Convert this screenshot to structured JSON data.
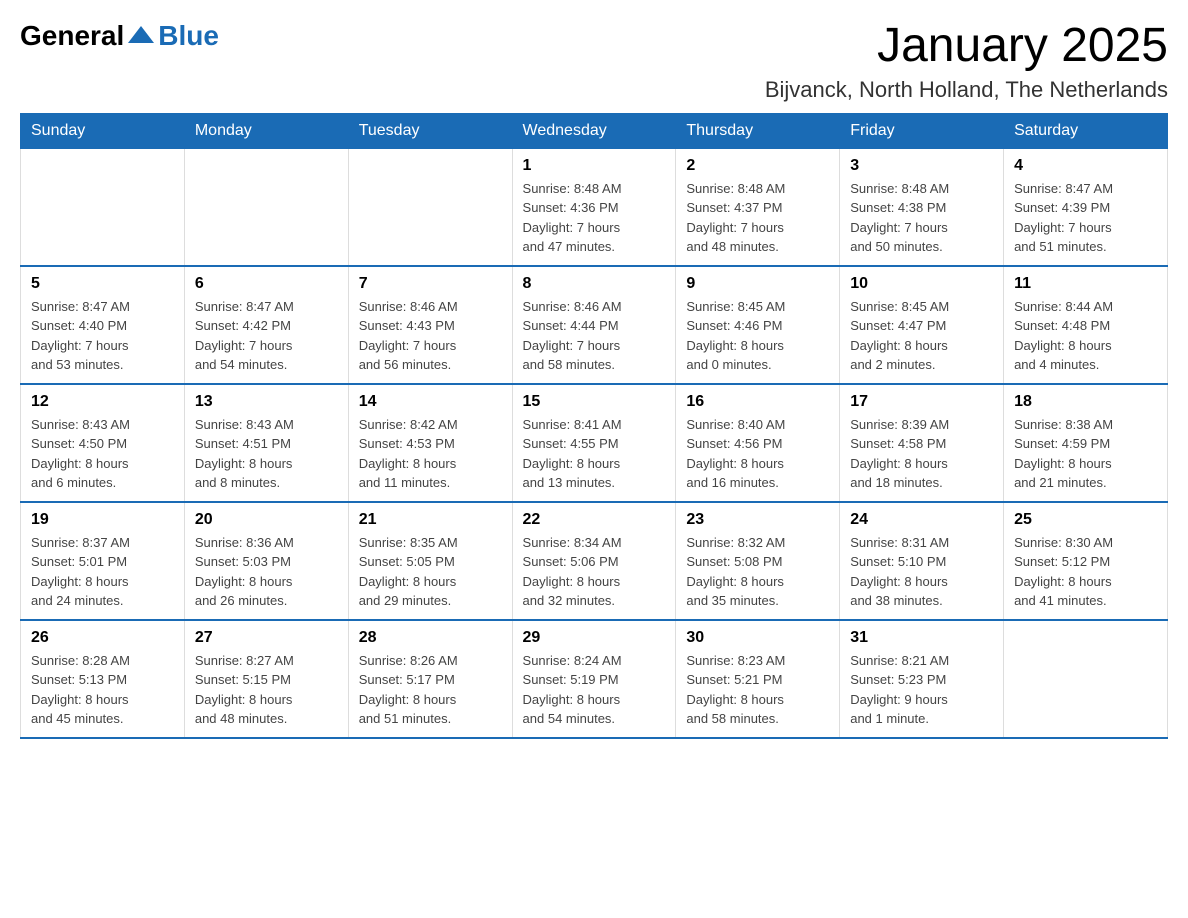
{
  "logo": {
    "general": "General",
    "blue": "Blue"
  },
  "header": {
    "month": "January 2025",
    "location": "Bijvanck, North Holland, The Netherlands"
  },
  "weekdays": [
    "Sunday",
    "Monday",
    "Tuesday",
    "Wednesday",
    "Thursday",
    "Friday",
    "Saturday"
  ],
  "weeks": [
    [
      {
        "day": "",
        "info": ""
      },
      {
        "day": "",
        "info": ""
      },
      {
        "day": "",
        "info": ""
      },
      {
        "day": "1",
        "info": "Sunrise: 8:48 AM\nSunset: 4:36 PM\nDaylight: 7 hours\nand 47 minutes."
      },
      {
        "day": "2",
        "info": "Sunrise: 8:48 AM\nSunset: 4:37 PM\nDaylight: 7 hours\nand 48 minutes."
      },
      {
        "day": "3",
        "info": "Sunrise: 8:48 AM\nSunset: 4:38 PM\nDaylight: 7 hours\nand 50 minutes."
      },
      {
        "day": "4",
        "info": "Sunrise: 8:47 AM\nSunset: 4:39 PM\nDaylight: 7 hours\nand 51 minutes."
      }
    ],
    [
      {
        "day": "5",
        "info": "Sunrise: 8:47 AM\nSunset: 4:40 PM\nDaylight: 7 hours\nand 53 minutes."
      },
      {
        "day": "6",
        "info": "Sunrise: 8:47 AM\nSunset: 4:42 PM\nDaylight: 7 hours\nand 54 minutes."
      },
      {
        "day": "7",
        "info": "Sunrise: 8:46 AM\nSunset: 4:43 PM\nDaylight: 7 hours\nand 56 minutes."
      },
      {
        "day": "8",
        "info": "Sunrise: 8:46 AM\nSunset: 4:44 PM\nDaylight: 7 hours\nand 58 minutes."
      },
      {
        "day": "9",
        "info": "Sunrise: 8:45 AM\nSunset: 4:46 PM\nDaylight: 8 hours\nand 0 minutes."
      },
      {
        "day": "10",
        "info": "Sunrise: 8:45 AM\nSunset: 4:47 PM\nDaylight: 8 hours\nand 2 minutes."
      },
      {
        "day": "11",
        "info": "Sunrise: 8:44 AM\nSunset: 4:48 PM\nDaylight: 8 hours\nand 4 minutes."
      }
    ],
    [
      {
        "day": "12",
        "info": "Sunrise: 8:43 AM\nSunset: 4:50 PM\nDaylight: 8 hours\nand 6 minutes."
      },
      {
        "day": "13",
        "info": "Sunrise: 8:43 AM\nSunset: 4:51 PM\nDaylight: 8 hours\nand 8 minutes."
      },
      {
        "day": "14",
        "info": "Sunrise: 8:42 AM\nSunset: 4:53 PM\nDaylight: 8 hours\nand 11 minutes."
      },
      {
        "day": "15",
        "info": "Sunrise: 8:41 AM\nSunset: 4:55 PM\nDaylight: 8 hours\nand 13 minutes."
      },
      {
        "day": "16",
        "info": "Sunrise: 8:40 AM\nSunset: 4:56 PM\nDaylight: 8 hours\nand 16 minutes."
      },
      {
        "day": "17",
        "info": "Sunrise: 8:39 AM\nSunset: 4:58 PM\nDaylight: 8 hours\nand 18 minutes."
      },
      {
        "day": "18",
        "info": "Sunrise: 8:38 AM\nSunset: 4:59 PM\nDaylight: 8 hours\nand 21 minutes."
      }
    ],
    [
      {
        "day": "19",
        "info": "Sunrise: 8:37 AM\nSunset: 5:01 PM\nDaylight: 8 hours\nand 24 minutes."
      },
      {
        "day": "20",
        "info": "Sunrise: 8:36 AM\nSunset: 5:03 PM\nDaylight: 8 hours\nand 26 minutes."
      },
      {
        "day": "21",
        "info": "Sunrise: 8:35 AM\nSunset: 5:05 PM\nDaylight: 8 hours\nand 29 minutes."
      },
      {
        "day": "22",
        "info": "Sunrise: 8:34 AM\nSunset: 5:06 PM\nDaylight: 8 hours\nand 32 minutes."
      },
      {
        "day": "23",
        "info": "Sunrise: 8:32 AM\nSunset: 5:08 PM\nDaylight: 8 hours\nand 35 minutes."
      },
      {
        "day": "24",
        "info": "Sunrise: 8:31 AM\nSunset: 5:10 PM\nDaylight: 8 hours\nand 38 minutes."
      },
      {
        "day": "25",
        "info": "Sunrise: 8:30 AM\nSunset: 5:12 PM\nDaylight: 8 hours\nand 41 minutes."
      }
    ],
    [
      {
        "day": "26",
        "info": "Sunrise: 8:28 AM\nSunset: 5:13 PM\nDaylight: 8 hours\nand 45 minutes."
      },
      {
        "day": "27",
        "info": "Sunrise: 8:27 AM\nSunset: 5:15 PM\nDaylight: 8 hours\nand 48 minutes."
      },
      {
        "day": "28",
        "info": "Sunrise: 8:26 AM\nSunset: 5:17 PM\nDaylight: 8 hours\nand 51 minutes."
      },
      {
        "day": "29",
        "info": "Sunrise: 8:24 AM\nSunset: 5:19 PM\nDaylight: 8 hours\nand 54 minutes."
      },
      {
        "day": "30",
        "info": "Sunrise: 8:23 AM\nSunset: 5:21 PM\nDaylight: 8 hours\nand 58 minutes."
      },
      {
        "day": "31",
        "info": "Sunrise: 8:21 AM\nSunset: 5:23 PM\nDaylight: 9 hours\nand 1 minute."
      },
      {
        "day": "",
        "info": ""
      }
    ]
  ]
}
